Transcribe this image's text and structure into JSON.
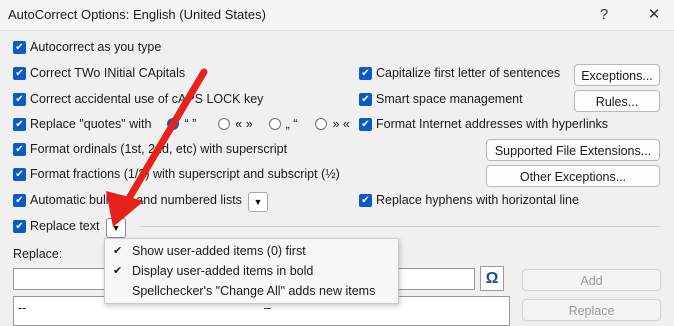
{
  "window": {
    "title": "AutoCorrect Options: English (United States)",
    "help_icon": "?",
    "close_icon": "✕"
  },
  "options": {
    "autocorrect_as_you_type": "Autocorrect as you type",
    "correct_two_initial_caps": "Correct TWo INitial CApitals",
    "correct_caps_lock": "Correct accidental use of cAPS LOCK key",
    "replace_quotes": "Replace \"quotes\" with",
    "format_ordinals": "Format ordinals (1st, 2nd, etc) with superscript",
    "format_fractions": "Format fractions (1/2) with superscript and subscript (½)",
    "automatic_bulleted": "Automatic bulleted and numbered lists",
    "replace_text": "Replace text",
    "capitalize_first": "Capitalize first letter of sentences",
    "smart_space": "Smart space management",
    "format_internet": "Format Internet addresses with hyperlinks",
    "replace_hyphens": "Replace hyphens with horizontal line"
  },
  "quote_styles": [
    {
      "label": "“ ”",
      "selected": true
    },
    {
      "label": "« »",
      "selected": false
    },
    {
      "label": "„ “",
      "selected": false
    },
    {
      "label": "» «",
      "selected": false
    }
  ],
  "buttons": {
    "exceptions": "Exceptions...",
    "rules": "Rules...",
    "supported_file_extensions": "Supported File Extensions...",
    "other_exceptions": "Other Exceptions...",
    "add": "Add",
    "replace": "Replace"
  },
  "replace_section": {
    "label": "Replace:",
    "omega_icon": "Ω",
    "list_first_row": "--",
    "list_first_value": "–"
  },
  "dropdown_menu": {
    "items": [
      {
        "label": "Show user-added items (0) first",
        "checked": true
      },
      {
        "label": "Display user-added items in bold",
        "checked": true
      },
      {
        "label": "Spellchecker's \"Change All\" adds new items",
        "checked": false
      }
    ]
  },
  "colors": {
    "accent": "#0a5cc2",
    "annotation_arrow": "#e8211a"
  }
}
